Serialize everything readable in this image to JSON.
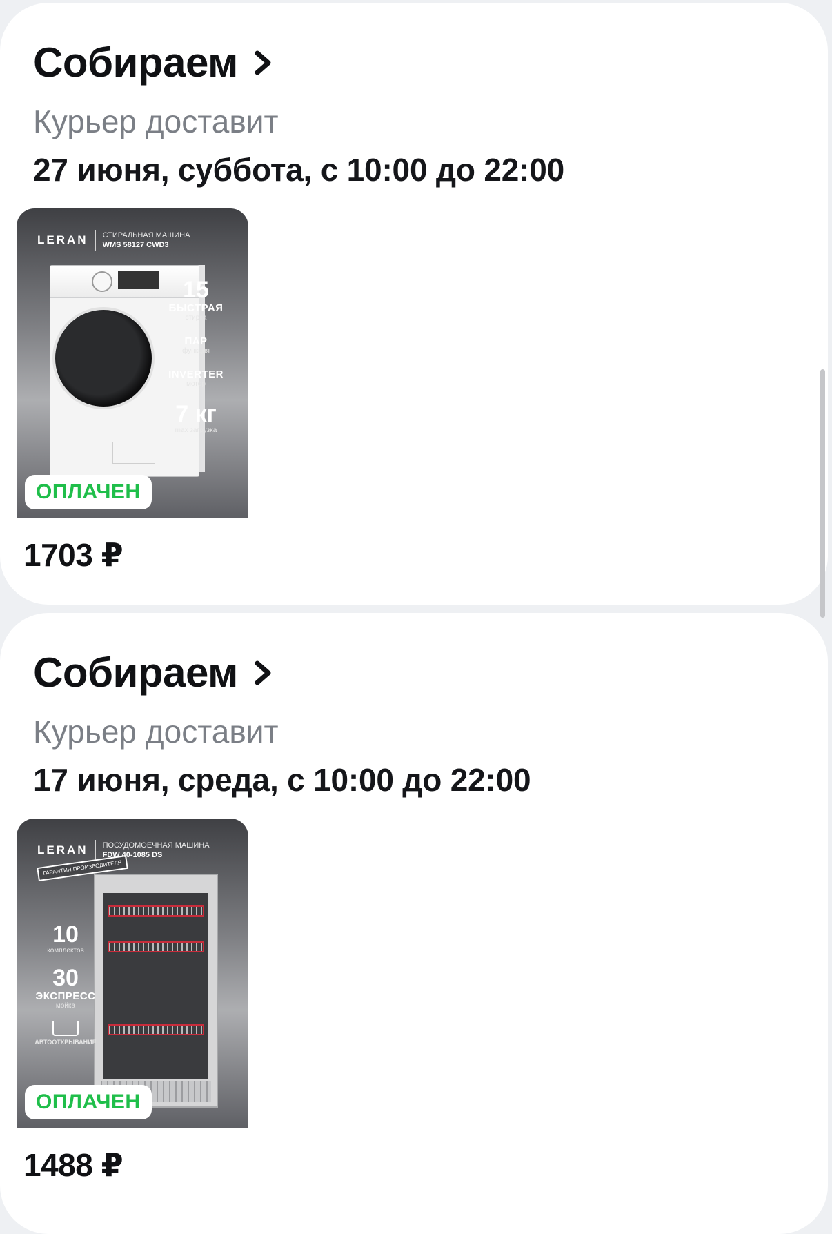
{
  "orders": [
    {
      "status": "Собираем",
      "delivery_method": "Курьер доставит",
      "delivery_date": "27 июня, суббота, с 10:00 до 22:00",
      "product": {
        "brand": "LERAN",
        "type": "СТИРАЛЬНАЯ МАШИНА",
        "model": "WMS 58127 CWD3",
        "features": [
          {
            "big": "15",
            "bold": "БЫСТРАЯ",
            "small": "стирка"
          },
          {
            "big": "",
            "bold": "ПАР",
            "small": "функция"
          },
          {
            "big": "",
            "bold": "INVERTER",
            "small": "мотор"
          },
          {
            "big": "7 кг",
            "bold": "",
            "small": "max загрузка"
          }
        ],
        "icon": "washing-machine-image"
      },
      "payment_badge": "ОПЛАЧЕН",
      "price": "1703 ₽"
    },
    {
      "status": "Собираем",
      "delivery_method": "Курьер доставит",
      "delivery_date": "17 июня, среда, с 10:00 до 22:00",
      "product": {
        "brand": "LERAN",
        "type": "ПОСУДОМОЕЧНАЯ МАШИНА",
        "model": "FDW 40-1085 DS",
        "warranty": "ГАРАНТИЯ ПРОИЗВОДИТЕЛЯ",
        "features": [
          {
            "big": "10",
            "bold": "",
            "small": "комплектов"
          },
          {
            "big": "30",
            "bold": "ЭКСПРЕСС",
            "small": "мойка"
          },
          {
            "big": "",
            "bold": "",
            "small": "АВТООТКРЫВАНИЕ"
          }
        ],
        "icon": "dishwasher-image"
      },
      "payment_badge": "ОПЛАЧЕН",
      "price": "1488 ₽"
    }
  ],
  "colors": {
    "background": "#eef0f3",
    "card": "#ffffff",
    "paid_green": "#1fbe4a",
    "secondary_text": "#7b7f86"
  }
}
